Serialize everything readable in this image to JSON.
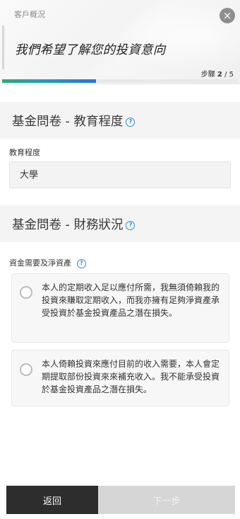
{
  "header": {
    "breadcrumb": "客戶概況",
    "headline": "我們希望了解您的投資意向",
    "step_label": "步驟",
    "step_current": "2",
    "step_total": "/ 5",
    "close_icon": "×",
    "progress_fraction": 0.4
  },
  "education": {
    "section_title": "基金問卷 - 教育程度",
    "field_label": "教育程度",
    "selected_value": "大學",
    "info_icon": "?"
  },
  "financial": {
    "section_title": "基金問卷 - 財務狀況",
    "field_label": "資金需要及淨資產",
    "info_icon": "?",
    "options": [
      {
        "text": "本人的定期收入足以應付所需，我無須倚賴我的投資來賺取定期收入，而我亦擁有足夠淨資產承受投資於基金投資產品之潛在損失。"
      },
      {
        "text": "本人倚賴投資來應付目前的收入需要，本人會定期提取部份投資來來補充收入。我不能承受投資於基金投資產品之潛在損失。"
      }
    ]
  },
  "footer": {
    "back_label": "返回",
    "next_label": "下一步"
  },
  "colors": {
    "progress_start": "#2eaa73",
    "progress_end": "#2677d0",
    "info_accent": "#2b8fd6",
    "back_button": "#2d2d2d",
    "next_button_disabled": "#d6d6d6"
  }
}
